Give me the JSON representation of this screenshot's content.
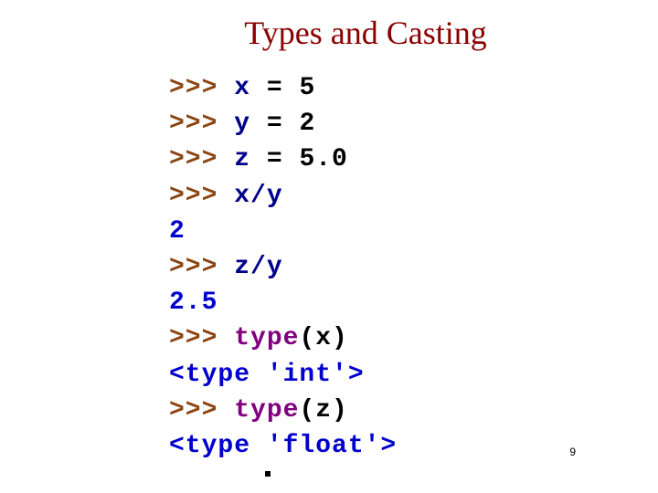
{
  "title": "Types and Casting",
  "code": {
    "l1_prompt": ">>> ",
    "l1_var": "x",
    "l1_rest": " = 5",
    "l2_prompt": ">>> ",
    "l2_var": "y",
    "l2_rest": " = 2",
    "l3_prompt": ">>> ",
    "l3_var": "z",
    "l3_rest": " = 5.0",
    "l4_prompt": ">>> ",
    "l4_expr": "x/y",
    "l5_output": "2",
    "l6_prompt": ">>> ",
    "l6_expr": "z/y",
    "l7_output": "2.5",
    "l8_prompt": ">>> ",
    "l8_builtin": "type",
    "l8_rest": "(x)",
    "l9_output": "<type 'int'>",
    "l10_prompt": ">>> ",
    "l10_builtin": "type",
    "l10_rest": "(z)",
    "l11_output": "<type 'float'>"
  },
  "page_number": "9"
}
